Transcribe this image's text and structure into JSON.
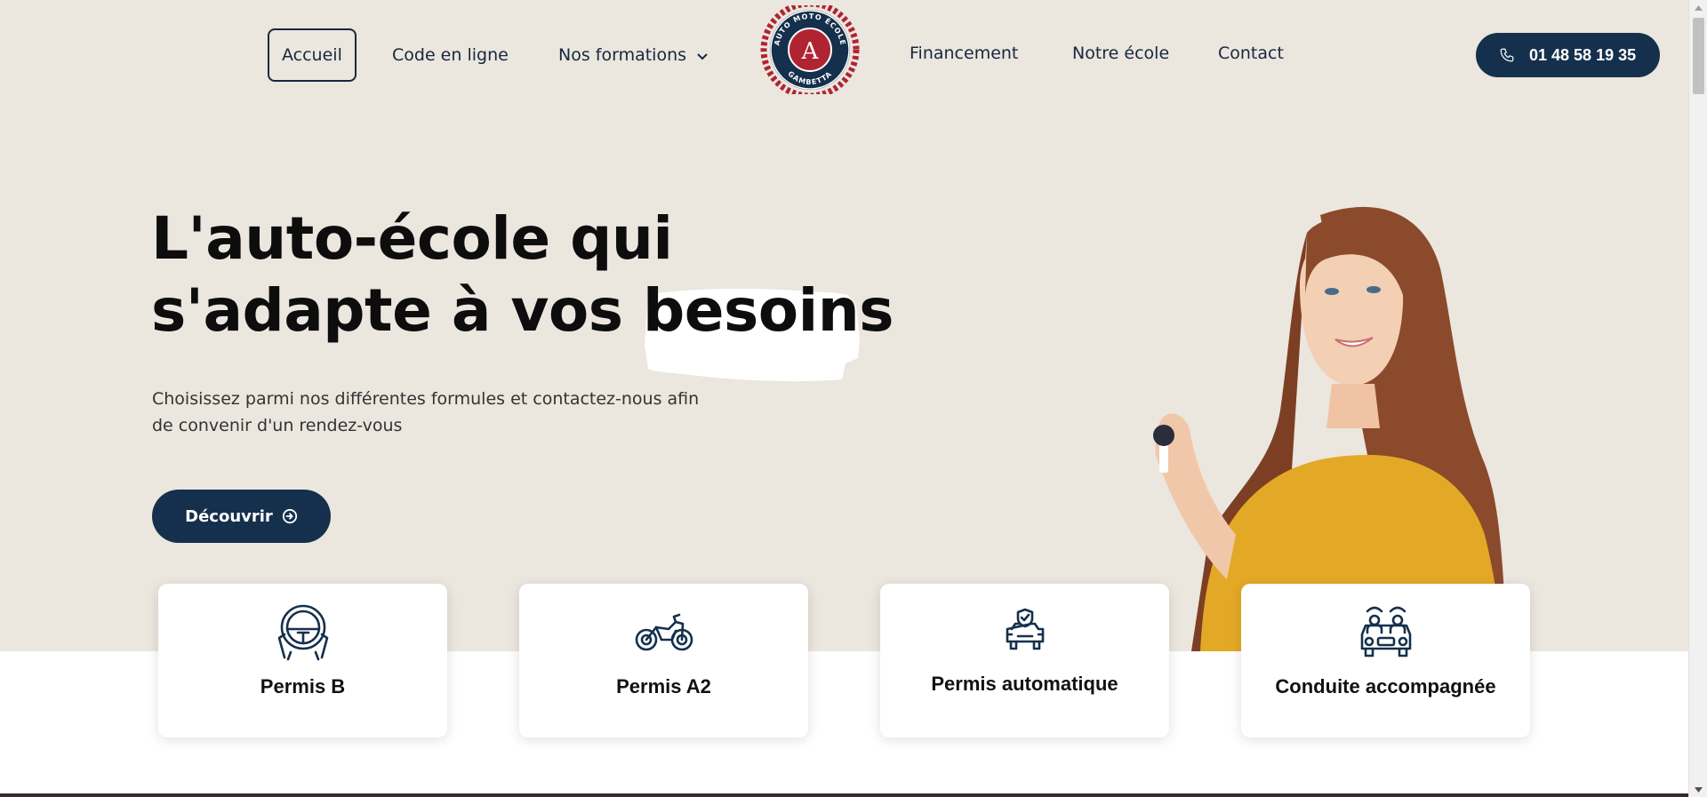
{
  "nav": {
    "items": [
      {
        "label": "Accueil",
        "active": true
      },
      {
        "label": "Code en ligne"
      },
      {
        "label": "Nos formations",
        "dropdown": true
      },
      {
        "label": "Financement"
      },
      {
        "label": "Notre école"
      },
      {
        "label": "Contact"
      }
    ],
    "logo": {
      "top_text": "AUTO MOTO ÉCOLE",
      "bottom_text": "GAMBETTA",
      "monogram": "A"
    },
    "phone": "01 48 58 19 35"
  },
  "hero": {
    "headline_line1": "L'auto-école qui",
    "headline_line2_start": "s'adapte à vos",
    "headline_highlight": "besoins",
    "subtitle": "Choisissez parmi nos différentes formules et contactez-nous afin de convenir d'un rendez-vous",
    "cta": "Découvrir"
  },
  "cards": [
    {
      "label": "Permis B",
      "icon": "steering-wheel-icon"
    },
    {
      "label": "Permis A2",
      "icon": "motorcycle-icon"
    },
    {
      "label": "Permis automatique",
      "icon": "car-shield-icon"
    },
    {
      "label": "Conduite accompagnée",
      "icon": "two-drivers-car-icon"
    }
  ],
  "colors": {
    "navy": "#15304c",
    "hero_bg": "#ebe6de",
    "sweater": "#e3a926",
    "logo_red": "#b02432"
  }
}
